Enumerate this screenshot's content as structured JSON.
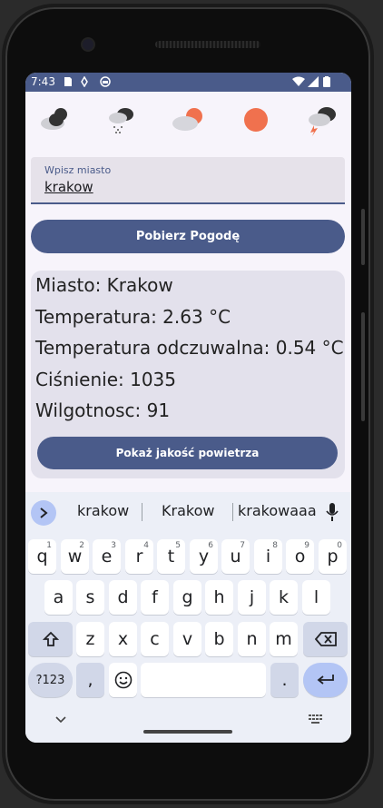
{
  "status": {
    "time": "7:43"
  },
  "weather_icons": [
    "cloudy-night-icon",
    "rain-snow-icon",
    "partly-cloudy-sun-icon",
    "sun-icon",
    "thunderstorm-icon"
  ],
  "search": {
    "label": "Wpisz miasto",
    "value": "krakow"
  },
  "buttons": {
    "fetch": "Pobierz Pogodę",
    "air_quality": "Pokaż jakość powietrza"
  },
  "weather": {
    "city": "Miasto: Krakow",
    "temperature": "Temperatura: 2.63 °C",
    "feels_like": "Temperatura odczuwalna: 0.54 °C",
    "pressure": "Ciśnienie: 1035",
    "humidity": "Wilgotnosc: 91"
  },
  "keyboard": {
    "suggestions": [
      "krakow",
      "Krakow",
      "krakowaaa"
    ],
    "row1": [
      [
        "q",
        "1"
      ],
      [
        "w",
        "2"
      ],
      [
        "e",
        "3"
      ],
      [
        "r",
        "4"
      ],
      [
        "t",
        "5"
      ],
      [
        "y",
        "6"
      ],
      [
        "u",
        "7"
      ],
      [
        "i",
        "8"
      ],
      [
        "o",
        "9"
      ],
      [
        "p",
        "0"
      ]
    ],
    "row2": [
      "a",
      "s",
      "d",
      "f",
      "g",
      "h",
      "j",
      "k",
      "l"
    ],
    "row3": [
      "z",
      "x",
      "c",
      "v",
      "b",
      "n",
      "m"
    ],
    "symbols_label": "?123",
    "comma": ",",
    "period": "."
  },
  "colors": {
    "accent": "#4a5b8a",
    "sun": "#f0714e",
    "screen_bg": "#f7f4fb",
    "card_bg": "#e3e1ec"
  }
}
